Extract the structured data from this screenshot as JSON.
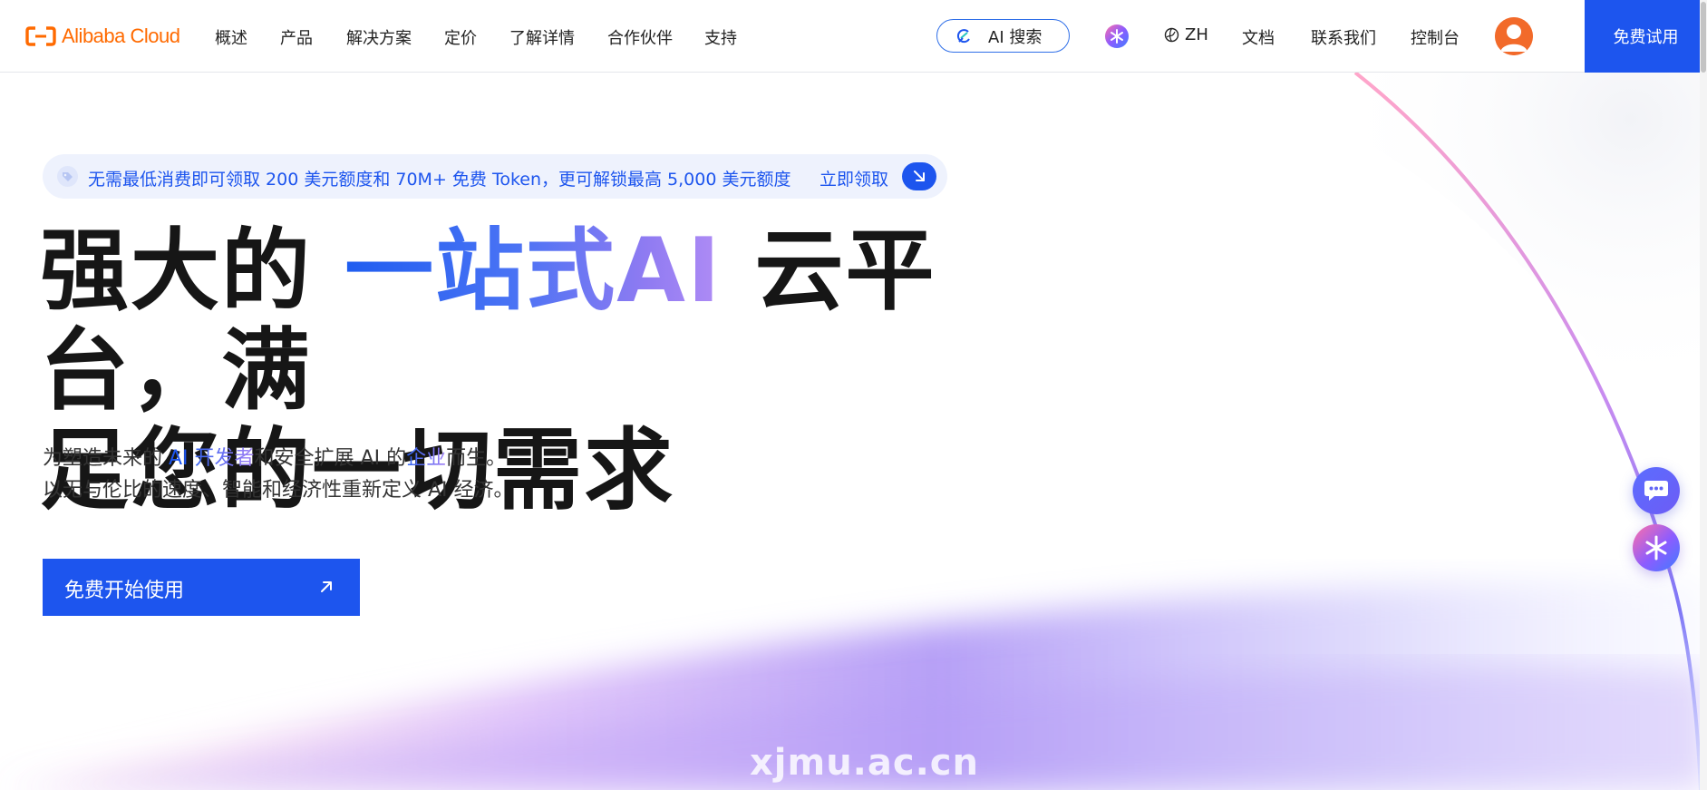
{
  "header": {
    "logo_text": "Alibaba Cloud",
    "nav": [
      "概述",
      "产品",
      "解决方案",
      "定价",
      "了解详情",
      "合作伙伴",
      "支持"
    ],
    "ai_search_label": "AI 搜索",
    "lang_label": "ZH",
    "docs_label": "文档",
    "contact_label": "联系我们",
    "console_label": "控制台",
    "free_trial_label": "免费试用"
  },
  "promo": {
    "text": "无需最低消费即可领取 200 美元额度和 70M+ 免费 Token，更可解锁最高 5,000 美元额度",
    "claim_label": "立即领取"
  },
  "hero": {
    "title_part1": "强大的 ",
    "title_highlight": "一站式AI",
    "title_part2": " 云平台，满",
    "title_line2": "足您的一切需求",
    "sub_line1_a": "为塑造未来的 ",
    "sub_line1_ai": "AI",
    "sub_line1_dev": " 开发者",
    "sub_line1_b": "和安全扩展 AI 的",
    "sub_line1_ent": "企业",
    "sub_line1_c": "而生。",
    "sub_line2": "以无与伦比的速度、智能和经济性重新定义 AI 经济。",
    "cta_label": "免费开始使用"
  },
  "watermark": "xjmu.ac.cn",
  "colors": {
    "brand_orange": "#ff6a00",
    "primary_blue": "#1d55ee",
    "gradient_purple": "#a07ef4"
  },
  "icons": {
    "logo": "alibaba-cloud-logo-icon",
    "ai_search": "ai-search-icon",
    "spark": "sparkle-icon",
    "lang": "globe-icon",
    "promo_tag": "tag-icon",
    "arrow": "arrow-diagonal-icon",
    "chat": "chat-bubble-icon"
  }
}
